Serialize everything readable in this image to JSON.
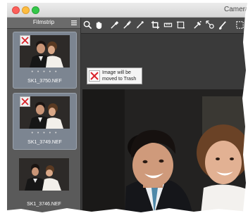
{
  "window": {
    "title": "Camera",
    "traffic_lights": [
      "close",
      "minimize",
      "zoom"
    ]
  },
  "filmstrip": {
    "title": "Filmstrip",
    "menu_icon": "hamburger-menu-icon",
    "items": [
      {
        "filename": "SK1_3750.NEF",
        "stars": "• • • • •",
        "marked_for_trash": true,
        "selected": true
      },
      {
        "filename": "SK1_3749.NEF",
        "stars": "• • • • •",
        "marked_for_trash": true,
        "selected": true
      },
      {
        "filename": "SK1_3746.NEF",
        "stars": "",
        "marked_for_trash": false,
        "selected": false
      }
    ]
  },
  "toolbar": {
    "tools": [
      {
        "name": "zoom-tool",
        "icon": "magnifier-icon"
      },
      {
        "name": "hand-tool",
        "icon": "hand-icon"
      },
      {
        "name": "white-balance-picker",
        "icon": "eyedropper-icon"
      },
      {
        "name": "color-sampler",
        "icon": "eyedropper-plus-icon"
      },
      {
        "name": "auto-retouch-brush",
        "icon": "brush-icon"
      },
      {
        "name": "crop-tool",
        "icon": "crop-icon"
      },
      {
        "name": "straighten-tool",
        "icon": "straighten-icon"
      },
      {
        "name": "perspective-tool",
        "icon": "perspective-icon"
      },
      {
        "name": "red-eye-tool",
        "icon": "red-eye-icon"
      },
      {
        "name": "control-point-tool",
        "icon": "control-point-icon"
      },
      {
        "name": "brush-tool",
        "icon": "paintbrush-icon"
      },
      {
        "name": "selection-tool",
        "icon": "selection-icon"
      }
    ]
  },
  "viewer": {
    "trash_notice": "Image will be moved to Trash"
  },
  "colors": {
    "trash_mark": "#d8232a",
    "selected_thumb": "#7c8591",
    "panel": "#5a5a5a",
    "toolbar": "#4a4a4a"
  }
}
